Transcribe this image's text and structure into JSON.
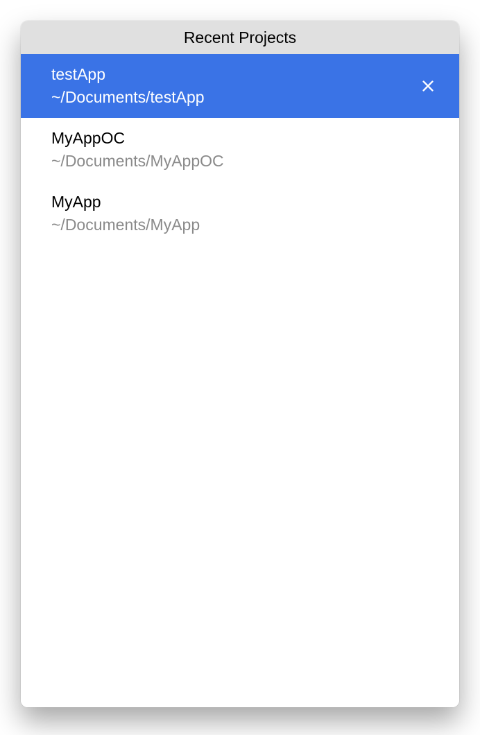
{
  "header": {
    "title": "Recent Projects"
  },
  "projects": [
    {
      "name": "testApp",
      "path": "~/Documents/testApp",
      "selected": true,
      "showClose": true
    },
    {
      "name": "MyAppOC",
      "path": "~/Documents/MyAppOC",
      "selected": false,
      "showClose": false
    },
    {
      "name": "MyApp",
      "path": "~/Documents/MyApp",
      "selected": false,
      "showClose": false
    }
  ]
}
